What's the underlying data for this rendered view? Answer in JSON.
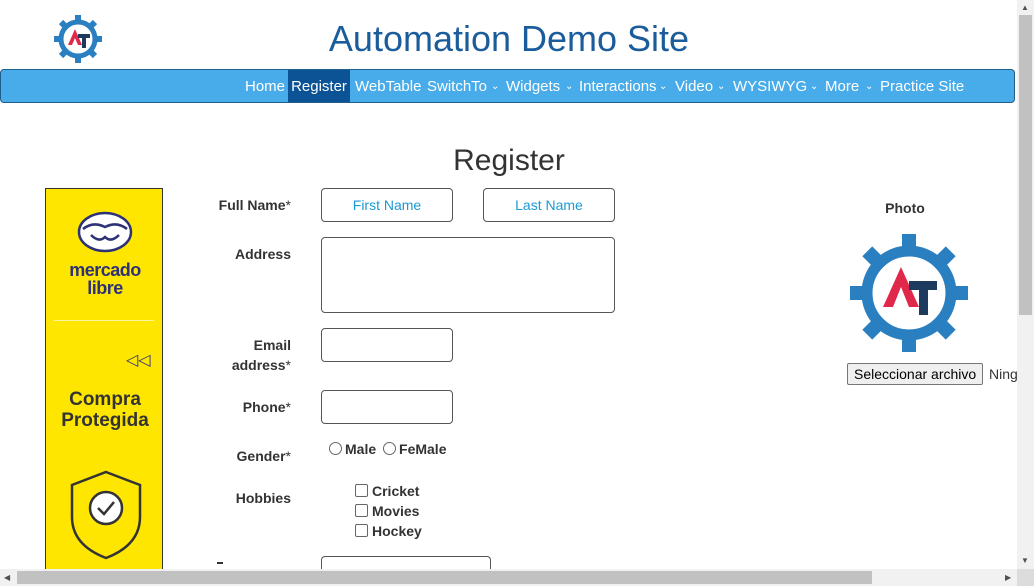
{
  "header": {
    "title": "Automation Demo Site"
  },
  "nav": {
    "items": [
      {
        "label": "Home",
        "active": false
      },
      {
        "label": "Register",
        "active": true
      },
      {
        "label": "WebTable",
        "active": false
      },
      {
        "label": "SwitchTo",
        "active": false,
        "has_dropdown": true
      },
      {
        "label": "Widgets",
        "active": false,
        "has_dropdown": true
      },
      {
        "label": "Interactions",
        "active": false,
        "has_dropdown": true
      },
      {
        "label": "Video",
        "active": false,
        "has_dropdown": true
      },
      {
        "label": "WYSIWYG",
        "active": false,
        "has_dropdown": true
      },
      {
        "label": "More",
        "active": false,
        "has_dropdown": true
      },
      {
        "label": "Practice Site",
        "active": false
      }
    ]
  },
  "page": {
    "heading": "Register"
  },
  "ad": {
    "brand_line1": "mercado",
    "brand_line2": "libre",
    "caption_line1": "Compra",
    "caption_line2": "Protegida"
  },
  "form": {
    "full_name_label": "Full Name",
    "first_name_placeholder": "First Name",
    "last_name_placeholder": "Last Name",
    "address_label": "Address",
    "email_label_line1": "Email",
    "email_label_line2": "address",
    "phone_label": "Phone",
    "required_mark": "*",
    "gender_label": "Gender",
    "gender_options": [
      "Male",
      "FeMale"
    ],
    "hobbies_label": "Hobbies",
    "hobbies": [
      "Cricket",
      "Movies",
      "Hockey"
    ]
  },
  "photo": {
    "label": "Photo",
    "file_button": "Seleccionar archivo",
    "file_status": "Ning"
  },
  "colors": {
    "nav_bg": "#49acea",
    "nav_active": "#0b5394",
    "title": "#1b5c9b",
    "placeholder": "#1a9ad6",
    "ad_bg": "#ffe600",
    "logo_blue": "#2a7fc1",
    "logo_red": "#e0294a",
    "logo_navy": "#1e3a5f"
  }
}
